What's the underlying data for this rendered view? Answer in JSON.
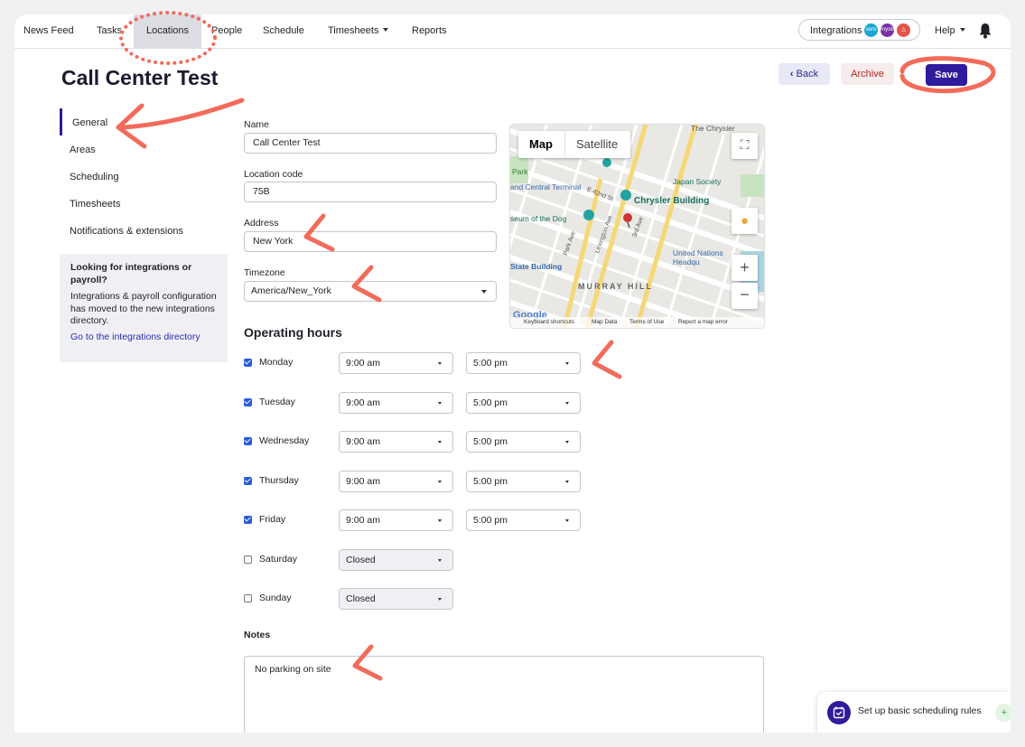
{
  "nav": {
    "items": [
      "News Feed",
      "Tasks",
      "Locations",
      "People",
      "Schedule",
      "Timesheets",
      "Reports"
    ],
    "active": "Locations",
    "integrations_label": "Integrations",
    "integration_logos": [
      "xero",
      "myob",
      "flame"
    ],
    "help_label": "Help"
  },
  "header": {
    "title": "Call Center Test",
    "back_label": "Back",
    "archive_label": "Archive",
    "save_label": "Save"
  },
  "sidebar": {
    "items": [
      "General",
      "Areas",
      "Scheduling",
      "Timesheets",
      "Notifications & extensions"
    ],
    "active": "General",
    "info": {
      "heading": "Looking for integrations or payroll?",
      "body": "Integrations & payroll configuration has moved to the new integrations directory.",
      "link": "Go to the integrations directory"
    }
  },
  "form": {
    "name_label": "Name",
    "name_value": "Call Center Test",
    "code_label": "Location code",
    "code_value": "75B",
    "address_label": "Address",
    "address_value": "New York",
    "timezone_label": "Timezone",
    "timezone_value": "America/New_York"
  },
  "hours": {
    "heading": "Operating hours",
    "days": [
      {
        "name": "Monday",
        "checked": true,
        "open": "9:00 am",
        "close": "5:00 pm"
      },
      {
        "name": "Tuesday",
        "checked": true,
        "open": "9:00 am",
        "close": "5:00 pm"
      },
      {
        "name": "Wednesday",
        "checked": true,
        "open": "9:00 am",
        "close": "5:00 pm"
      },
      {
        "name": "Thursday",
        "checked": true,
        "open": "9:00 am",
        "close": "5:00 pm"
      },
      {
        "name": "Friday",
        "checked": true,
        "open": "9:00 am",
        "close": "5:00 pm"
      },
      {
        "name": "Saturday",
        "checked": false,
        "open": "Closed",
        "close": ""
      },
      {
        "name": "Sunday",
        "checked": false,
        "open": "Closed",
        "close": ""
      }
    ]
  },
  "notes": {
    "label": "Notes",
    "value": "No parking on site"
  },
  "map": {
    "tab_map": "Map",
    "tab_satellite": "Satellite",
    "labels": [
      "Park",
      "and Central Terminal",
      "E 42nd St",
      "Chrysler Building",
      "Japan Society",
      "seum of the Dog",
      "Park Ave",
      "Lexington Ave",
      "3rd Ave",
      "State Building",
      "United Nations Headqu",
      "MURRAY HILL",
      "The Chrysler"
    ],
    "footer": [
      "Keyboard shortcuts",
      "Map Data",
      "Terms of Use",
      "Report a map error"
    ],
    "google": "Google"
  },
  "toast": {
    "text": "Set up basic scheduling rules"
  },
  "colors": {
    "accent": "#2e1b9d",
    "archive": "#b3261e",
    "annotation": "#f26b5b",
    "checkbox": "#2a5bd7"
  }
}
